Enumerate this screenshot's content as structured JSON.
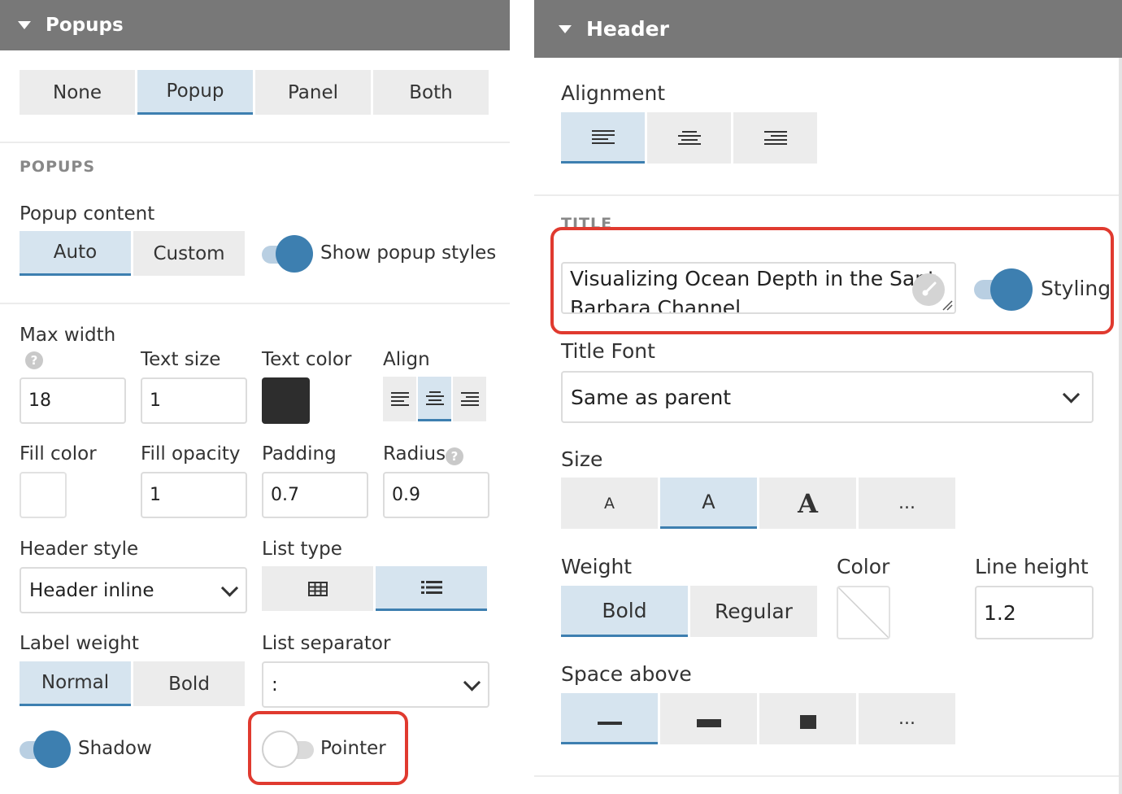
{
  "left": {
    "header": "Popups",
    "mode_tabs": [
      "None",
      "Popup",
      "Panel",
      "Both"
    ],
    "mode_selected": "Popup",
    "section_popups": "POPUPS",
    "popup_content_label": "Popup content",
    "content_tabs": [
      "Auto",
      "Custom"
    ],
    "show_styles_label": "Show popup styles",
    "max_width_label": "Max width",
    "max_width_value": "18",
    "text_size_label": "Text size",
    "text_size_value": "1",
    "text_color_label": "Text color",
    "text_color": "#2d2d2d",
    "align_label": "Align",
    "fill_color_label": "Fill color",
    "fill_opacity_label": "Fill opacity",
    "fill_opacity_value": "1",
    "padding_label": "Padding",
    "padding_value": "0.7",
    "radius_label": "Radius",
    "radius_value": "0.9",
    "header_style_label": "Header style",
    "header_style_value": "Header inline",
    "list_type_label": "List type",
    "label_weight_label": "Label weight",
    "weight_tabs": [
      "Normal",
      "Bold"
    ],
    "list_separator_label": "List separator",
    "list_separator_value": ":",
    "shadow_label": "Shadow",
    "pointer_label": "Pointer",
    "help_glyph": "?"
  },
  "right": {
    "header": "Header",
    "alignment_label": "Alignment",
    "section_title": "TITLE",
    "title_value": "Visualizing Ocean Depth in the Santa Barbara Channel",
    "title_line1": "Visualizing Ocean Depth in the Sant",
    "title_line2": "Barbara Channel",
    "styling_label": "Styling",
    "title_font_label": "Title Font",
    "title_font_value": "Same as parent",
    "size_label": "Size",
    "size_tabs": [
      "A",
      "A",
      "A",
      "..."
    ],
    "weight_label": "Weight",
    "weight_tabs": [
      "Bold",
      "Regular"
    ],
    "color_label": "Color",
    "line_height_label": "Line height",
    "line_height_value": "1.2",
    "space_above_label": "Space above",
    "more": "..."
  },
  "colors": {
    "accent": "#3d7fb0",
    "toggle_on": "#3d7fb0",
    "highlight": "#e03a2f",
    "header_bg": "#787878"
  }
}
